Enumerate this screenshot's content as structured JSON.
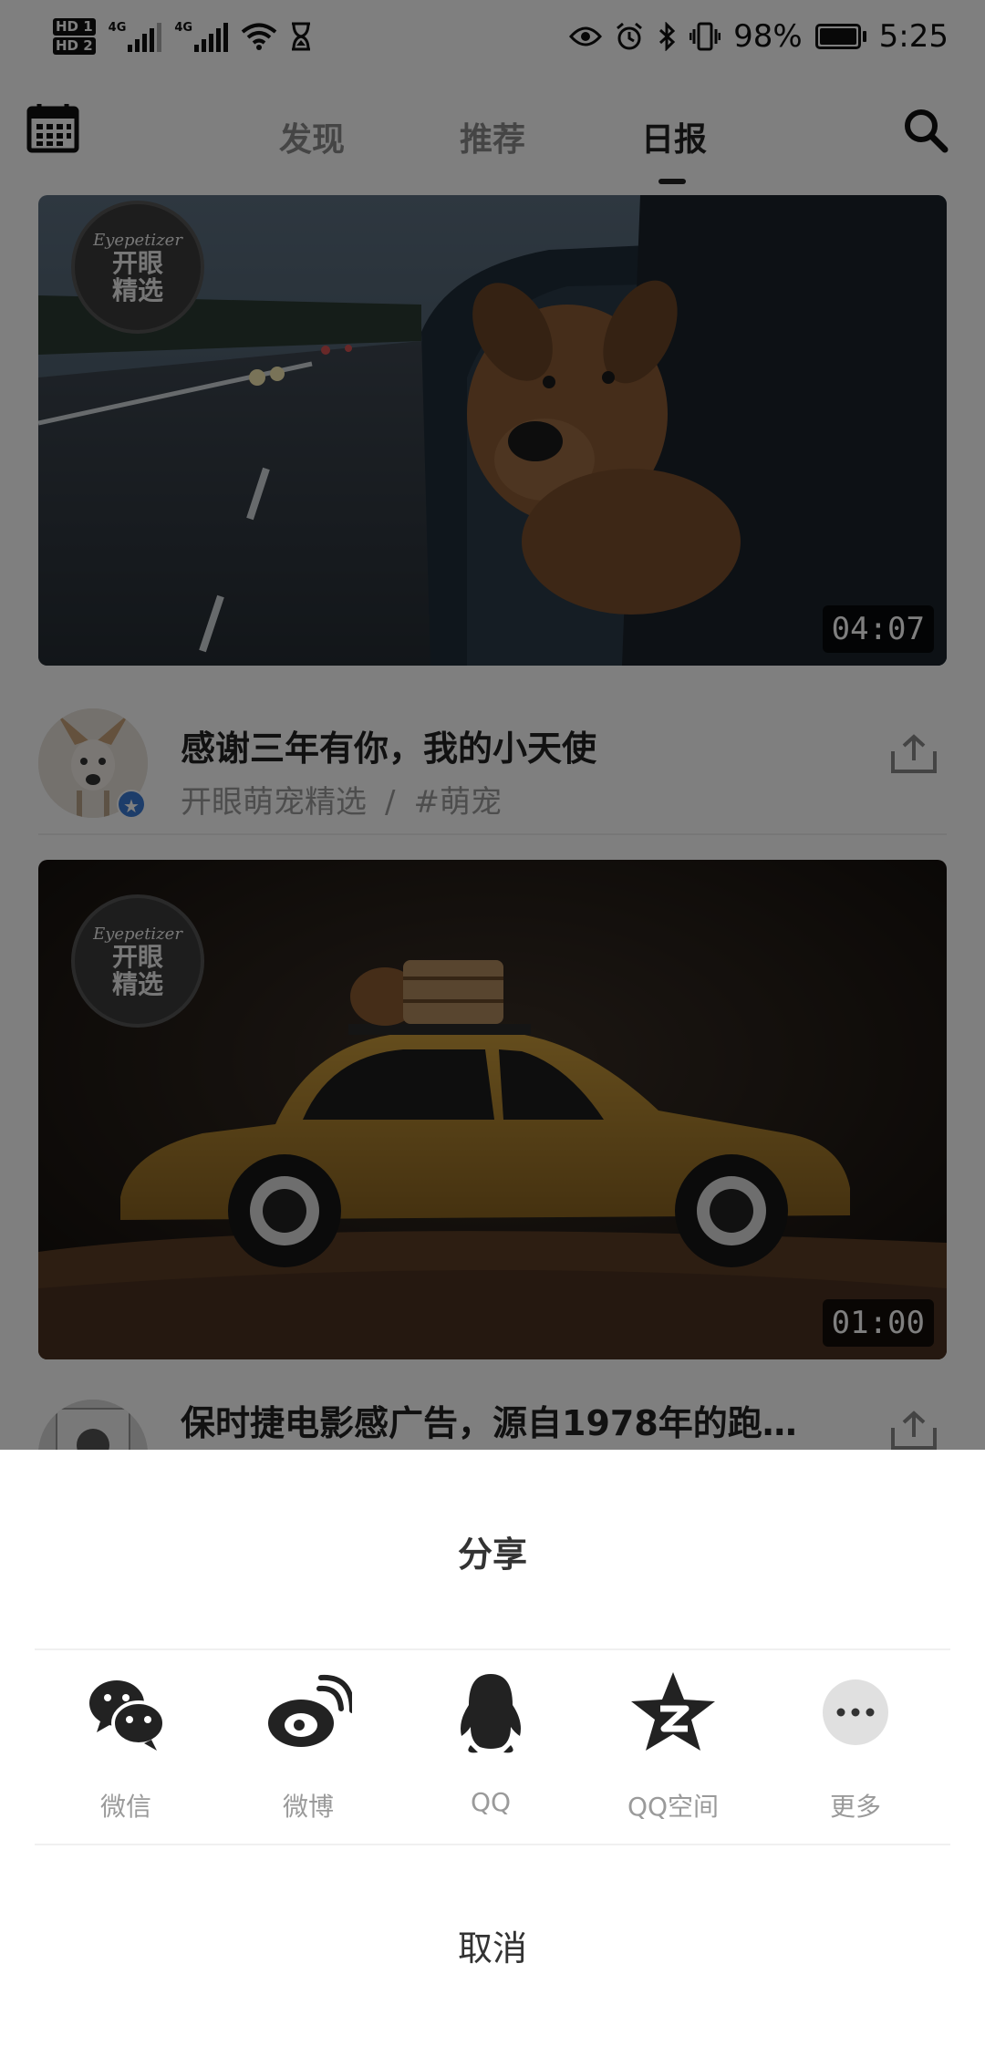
{
  "status_bar": {
    "hd1": "HD 1",
    "hd2": "HD 2",
    "net1": "4G",
    "net2": "4G",
    "battery_percent": "98%",
    "time": "5:25"
  },
  "nav": {
    "tabs": [
      {
        "label": "发现"
      },
      {
        "label": "推荐"
      },
      {
        "label": "日报"
      }
    ],
    "active_tab": "日报",
    "icons": {
      "left": "calendar-icon",
      "right": "search-icon"
    }
  },
  "feed": [
    {
      "badge": {
        "top": "Eyepetizer",
        "line1": "开眼",
        "line2": "精选"
      },
      "duration": "04:07",
      "title": "感谢三年有你，我的小天使",
      "author": "开眼萌宠精选",
      "separator": "/",
      "tag": "#萌宠"
    },
    {
      "badge": {
        "top": "Eyepetizer",
        "line1": "开眼",
        "line2": "精选"
      },
      "duration": "01:00",
      "title": "保时捷电影感广告，源自1978年的跑…"
    }
  ],
  "share_sheet": {
    "title": "分享",
    "options": [
      {
        "label": "微信",
        "icon": "wechat-icon"
      },
      {
        "label": "微博",
        "icon": "weibo-icon"
      },
      {
        "label": "QQ",
        "icon": "qq-icon"
      },
      {
        "label": "QQ空间",
        "icon": "qzone-icon"
      },
      {
        "label": "更多",
        "icon": "more-icon"
      }
    ],
    "cancel": "取消"
  }
}
